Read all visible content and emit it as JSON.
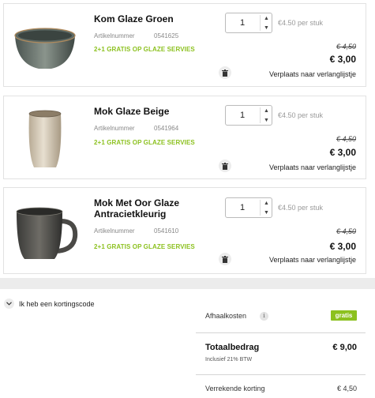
{
  "items": [
    {
      "title": "Kom Glaze Groen",
      "article_label": "Artikelnummer",
      "article_number": "0541625",
      "promo": "2+1 GRATIS OP GLAZE SERVIES",
      "quantity": "1",
      "unit_price": "€4.50 per stuk",
      "old_price": "€ 4,50",
      "new_price": "€ 3,00",
      "wishlist": "Verplaats naar verlanglijstje",
      "image_icon": "bowl-icon"
    },
    {
      "title": "Mok Glaze Beige",
      "article_label": "Artikelnummer",
      "article_number": "0541964",
      "promo": "2+1 GRATIS OP GLAZE SERVIES",
      "quantity": "1",
      "unit_price": "€4.50 per stuk",
      "old_price": "€ 4,50",
      "new_price": "€ 3,00",
      "wishlist": "Verplaats naar verlanglijstje",
      "image_icon": "cup-icon"
    },
    {
      "title": "Mok Met Oor Glaze Antracietkleurig",
      "article_label": "Artikelnummer",
      "article_number": "0541610",
      "promo": "2+1 GRATIS OP GLAZE SERVIES",
      "quantity": "1",
      "unit_price": "€4.50 per stuk",
      "old_price": "€ 4,50",
      "new_price": "€ 3,00",
      "wishlist": "Verplaats naar verlanglijstje",
      "image_icon": "mug-icon"
    }
  ],
  "coupon": {
    "label": "Ik heb een kortingscode"
  },
  "summary": {
    "pickup_label": "Afhaalkosten",
    "info_glyph": "i",
    "pickup_value": "gratis",
    "total_label": "Totaalbedrag",
    "total_value": "€ 9,00",
    "vat_note": "Inclusief 21% BTW",
    "discount_label": "Verrekende korting",
    "discount_value": "€ 4,50"
  },
  "colors": {
    "accent_green": "#8cc11f",
    "border": "#e2e2e2",
    "band": "#ececec"
  }
}
